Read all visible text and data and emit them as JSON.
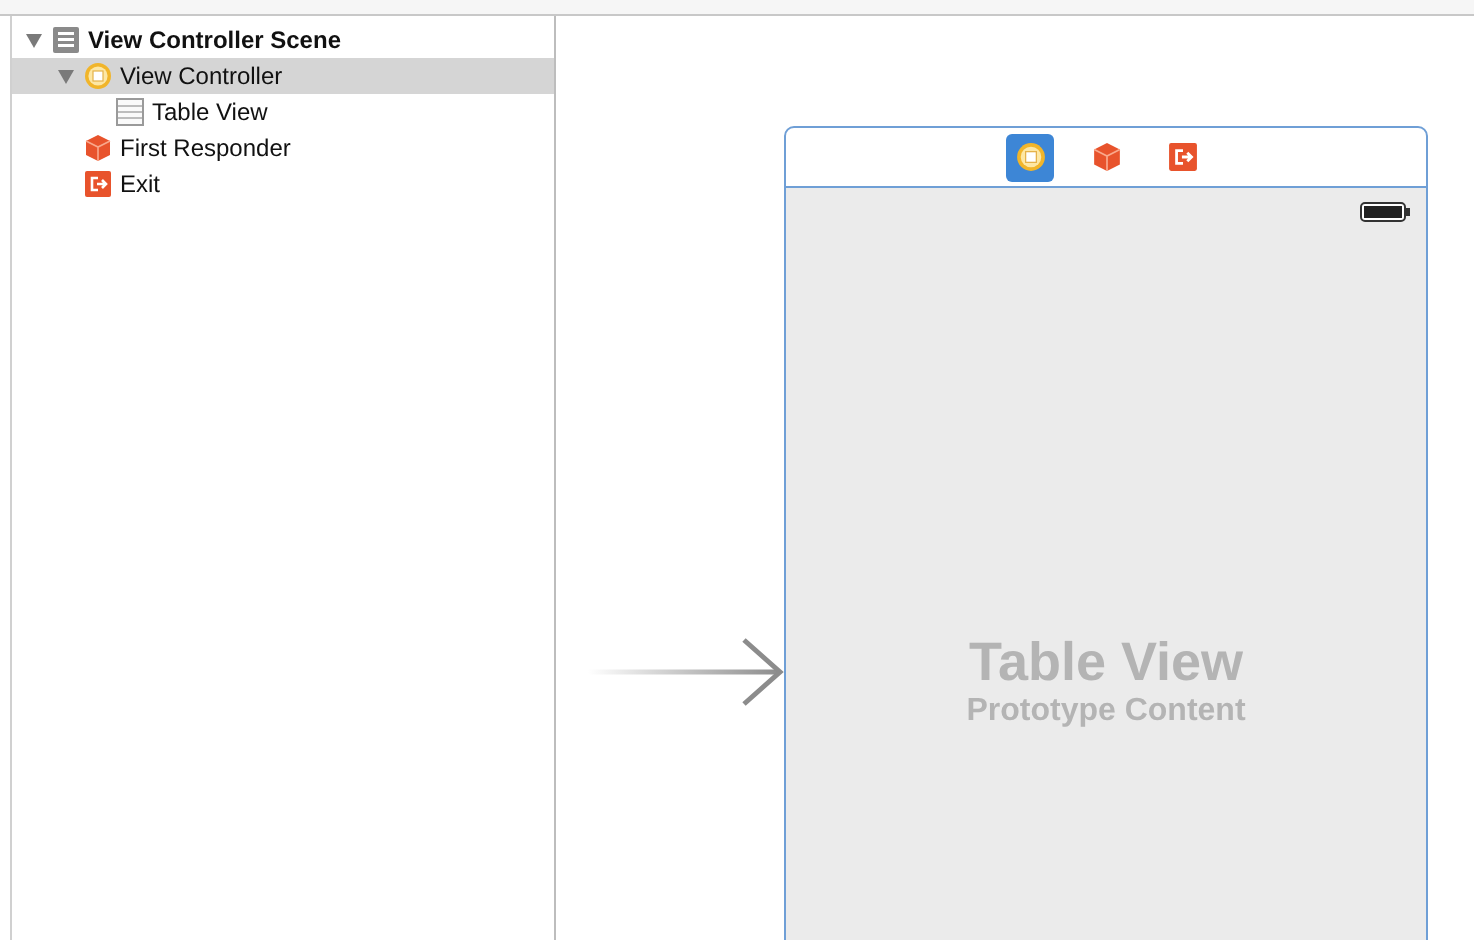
{
  "outline": [
    {
      "label": "View Controller Scene",
      "kind": "scene",
      "expanded": true,
      "selected": false,
      "children": [
        {
          "label": "View Controller",
          "kind": "controller",
          "expanded": true,
          "selected": true,
          "children": [
            {
              "label": "Table View",
              "kind": "table",
              "selected": false
            }
          ]
        },
        {
          "label": "First Responder",
          "kind": "responder",
          "selected": false
        },
        {
          "label": "Exit",
          "kind": "exit",
          "selected": false
        }
      ]
    }
  ],
  "scene": {
    "dock": [
      {
        "kind": "controller",
        "selected": true
      },
      {
        "kind": "responder",
        "selected": false
      },
      {
        "kind": "exit",
        "selected": false
      }
    ],
    "title": "Table View",
    "subtitle": "Prototype Content"
  }
}
